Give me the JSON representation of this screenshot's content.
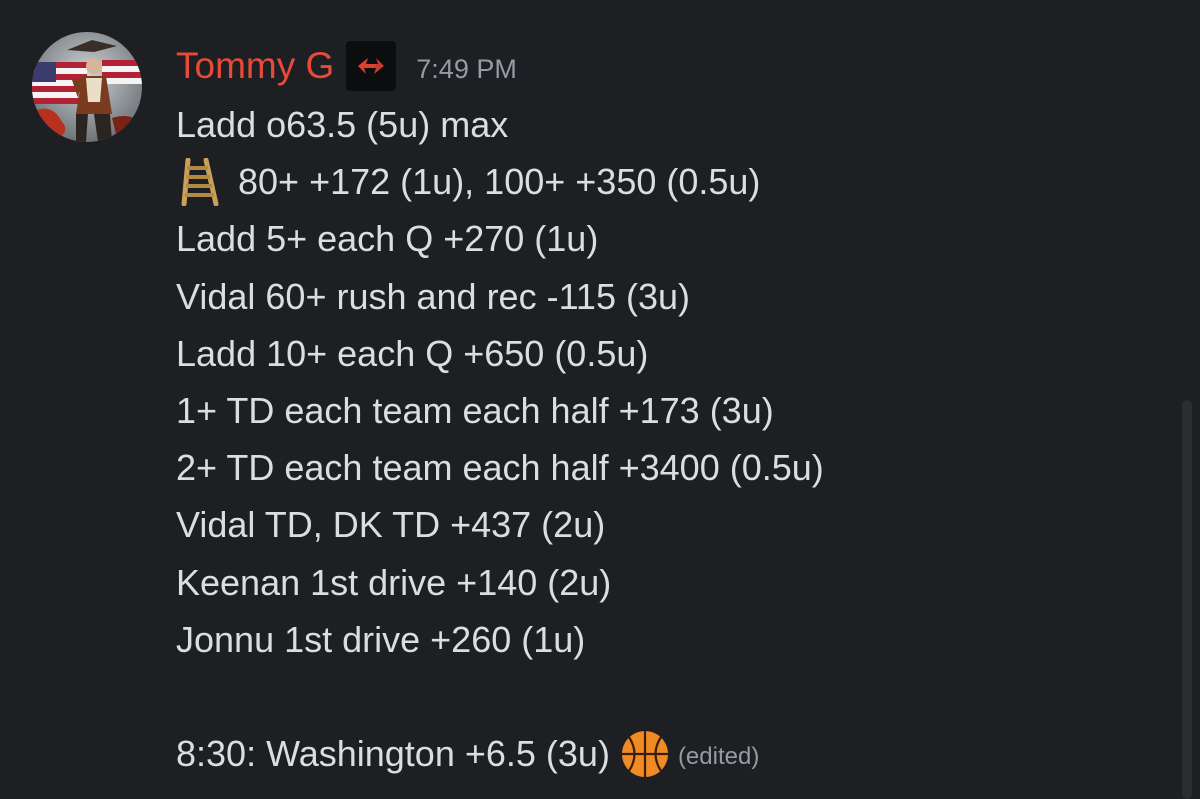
{
  "message": {
    "author": "Tommy G",
    "timestamp": "7:49 PM",
    "lines": [
      "Ladd o63.5 (5u) max",
      "80+ +172 (1u), 100+ +350 (0.5u)",
      "Ladd 5+ each Q +270 (1u)",
      "Vidal 60+ rush and rec -115 (3u)",
      "Ladd 10+ each Q +650 (0.5u)",
      "1+ TD each team each half +173 (3u)",
      "2+ TD each team each half +3400 (0.5u)",
      "Vidal TD, DK TD +437 (2u)",
      "Keenan 1st drive +140 (2u)",
      "Jonnu 1st drive +260 (1u)",
      "8:30: Washington +6.5 (3u)"
    ],
    "edited_label": "(edited)",
    "icons": {
      "ladder": "ladder-emoji",
      "basketball": "basketball-emoji",
      "role": "red-arrows-role-icon"
    }
  },
  "colors": {
    "background": "#1e1f22",
    "username": "#e84a3a",
    "text": "#dbdee1",
    "muted": "#949ba4"
  }
}
